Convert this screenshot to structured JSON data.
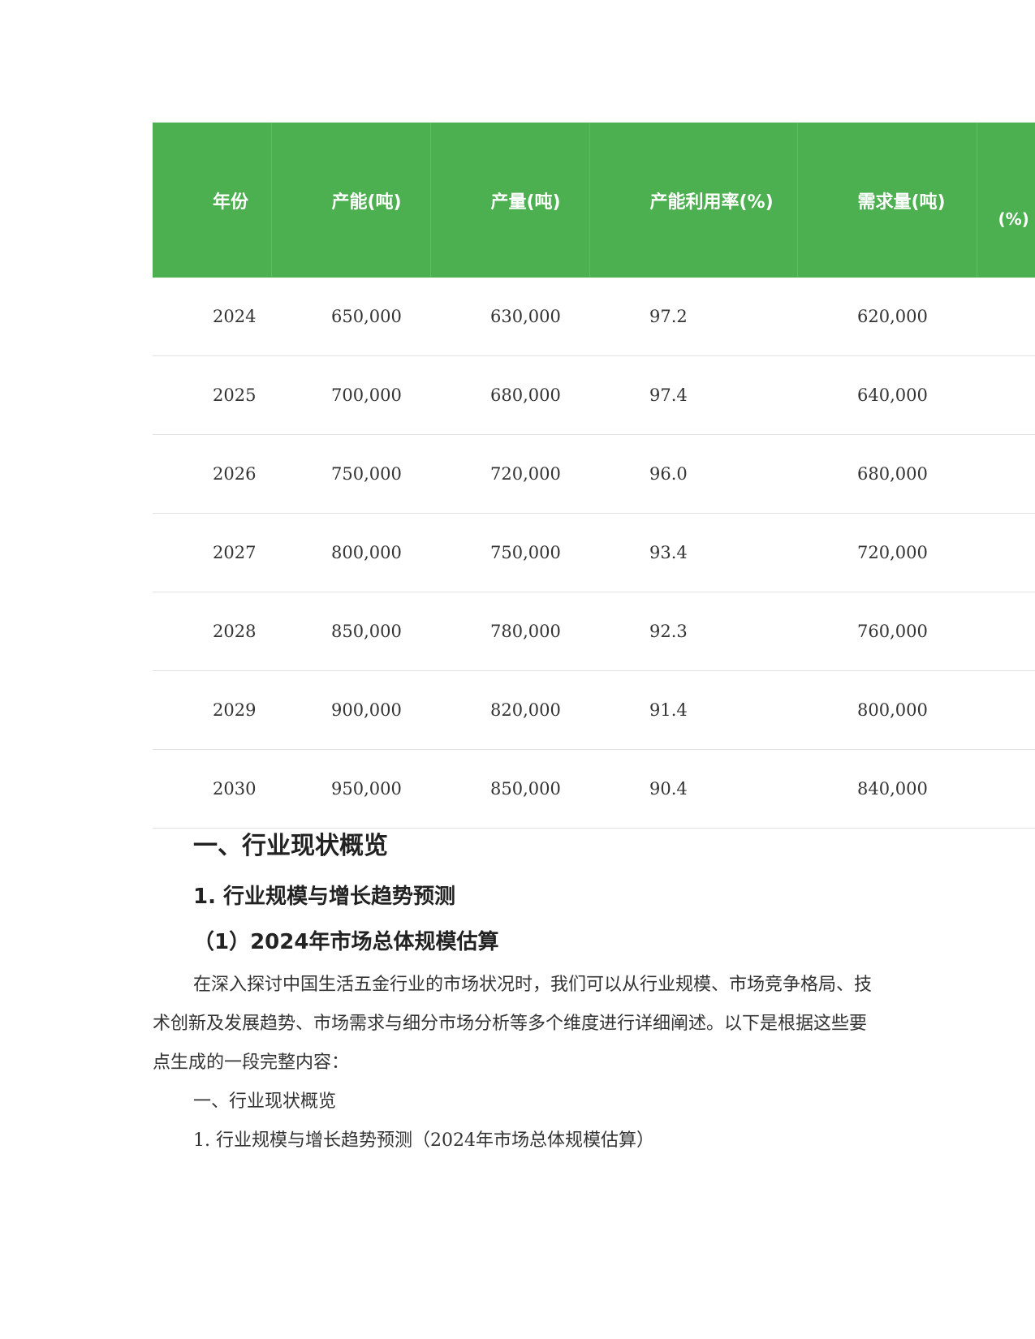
{
  "table": {
    "headers": [
      "年份",
      "产能(吨)",
      "产量(吨)",
      "产能利用率(%)",
      "需求量(吨)",
      "(%)"
    ],
    "rows": [
      [
        "2024",
        "650,000",
        "630,000",
        "97.2",
        "620,000"
      ],
      [
        "2025",
        "700,000",
        "680,000",
        "97.4",
        "640,000"
      ],
      [
        "2026",
        "750,000",
        "720,000",
        "96.0",
        "680,000"
      ],
      [
        "2027",
        "800,000",
        "750,000",
        "93.4",
        "720,000"
      ],
      [
        "2028",
        "850,000",
        "780,000",
        "92.3",
        "760,000"
      ],
      [
        "2029",
        "900,000",
        "820,000",
        "91.4",
        "800,000"
      ],
      [
        "2030",
        "950,000",
        "850,000",
        "90.4",
        "840,000"
      ]
    ],
    "header_color": "#4caf50"
  },
  "headings": {
    "h1": "一、行业现状概览",
    "h2": "1. 行业规模与增长趋势预测",
    "h3": "（1）2024年市场总体规模估算"
  },
  "body": {
    "paragraph": "在深入探讨中国生活五金行业的市场状况时，我们可以从行业规模、市场竞争格局、技术创新及发展趋势、市场需求与细分市场分析等多个维度进行详细阐述。以下是根据这些要点生成的一段完整内容：",
    "line1": "一、行业现状概览",
    "line2": "1. 行业规模与增长趋势预测（2024年市场总体规模估算）"
  }
}
